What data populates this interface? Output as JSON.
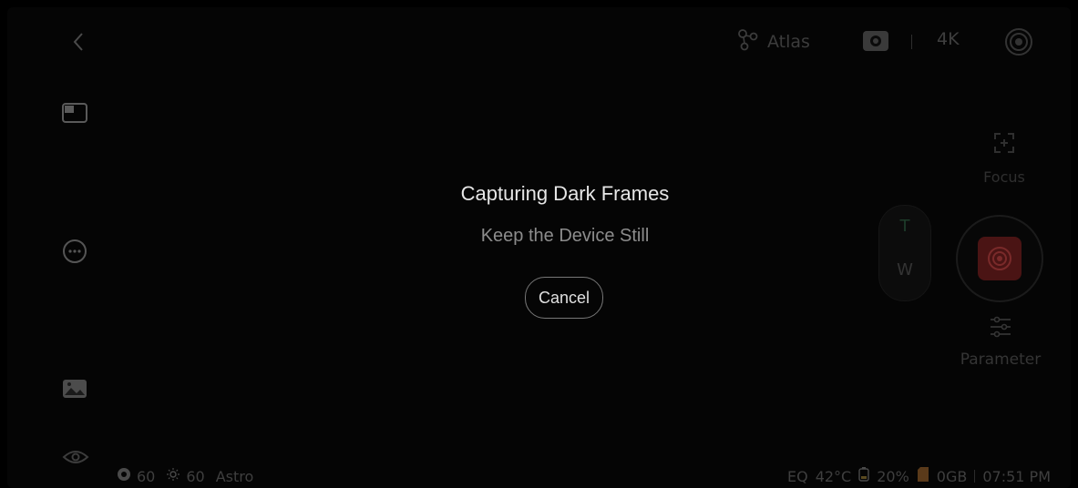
{
  "top_bar": {
    "atlas_label": "Atlas",
    "resolution_label": "4K"
  },
  "right_panel": {
    "focus_label": "Focus",
    "zoom_tele_label": "T",
    "zoom_wide_label": "W",
    "parameter_label": "Parameter"
  },
  "dialog": {
    "title": "Capturing Dark Frames",
    "subtitle": "Keep the Device Still",
    "cancel_label": "Cancel"
  },
  "status_left": {
    "value_a": "60",
    "value_b": "60",
    "mode": "Astro"
  },
  "status_right": {
    "eq": "EQ",
    "temperature": "42°C",
    "battery": "20%",
    "storage": "0GB",
    "time": "07:51 PM"
  },
  "colors": {
    "background": "#000000",
    "dialog_text": "#e6e6e6",
    "dialog_subtext": "#8c8c8c",
    "shutter_accent": "#4a1414"
  },
  "icons": [
    "back-icon",
    "album-icon",
    "more-icon",
    "gallery-icon",
    "eye-icon",
    "atlas-icon",
    "camera-mode-icon",
    "record-mode-icon",
    "focus-icon",
    "parameter-icon",
    "shutter-icon",
    "aperture-icon",
    "sun-icon",
    "battery-icon",
    "storage-icon"
  ]
}
